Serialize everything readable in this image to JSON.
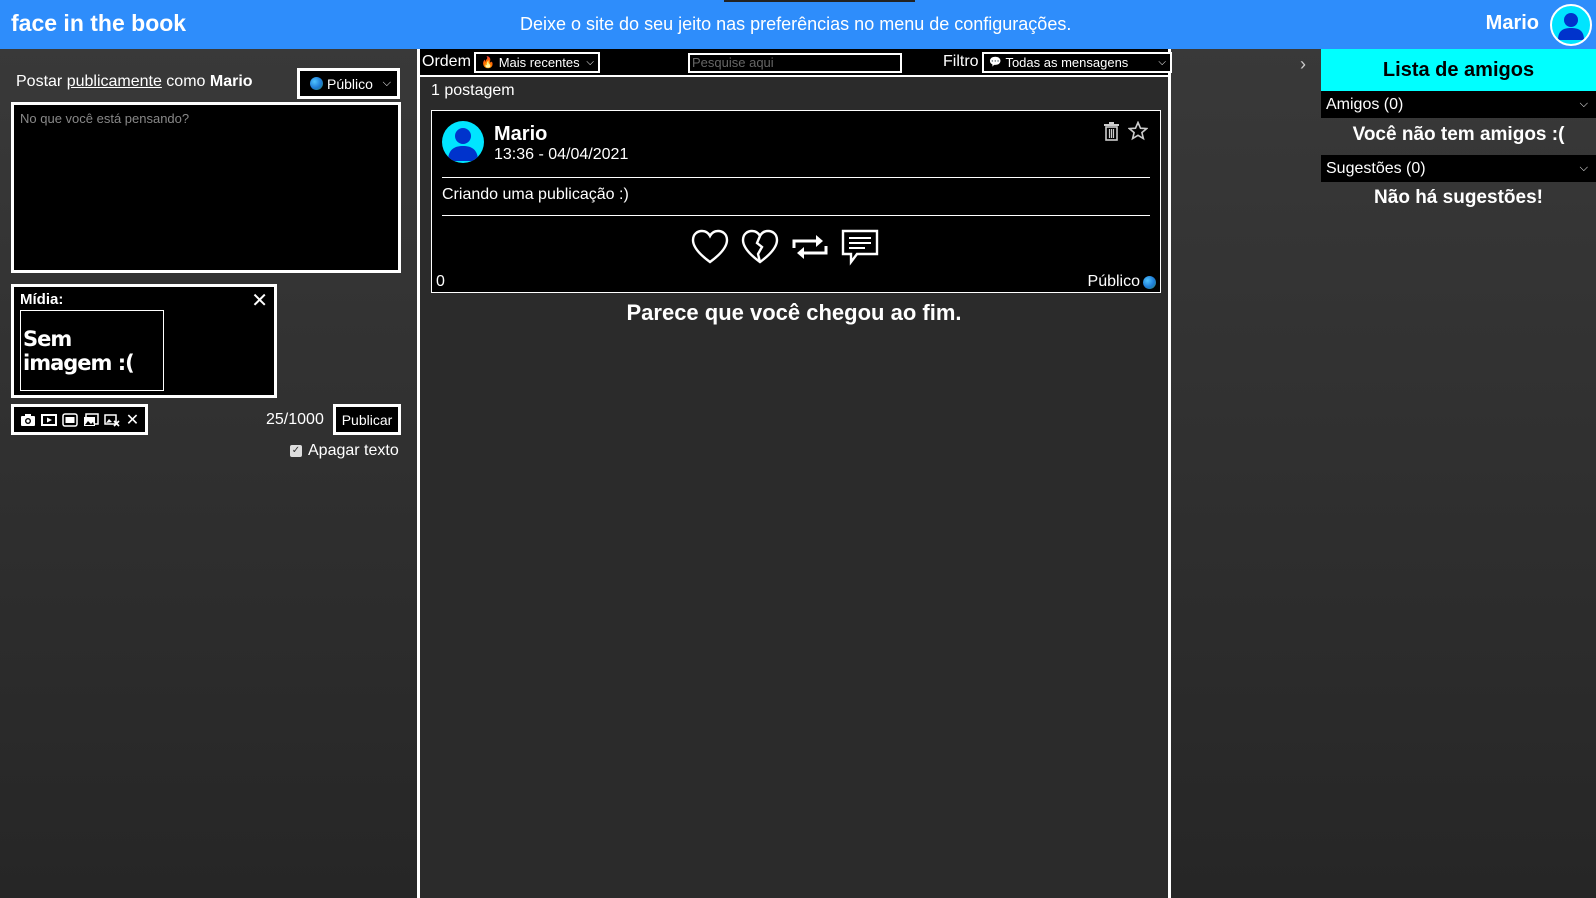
{
  "header": {
    "logo": "face in the book",
    "message": "Deixe o site do seu jeito nas preferências no menu de configurações.",
    "username": "Mario"
  },
  "composer": {
    "post_prefix": "Postar ",
    "post_link": "publicamente",
    "post_middle": " como ",
    "post_user": "Mario",
    "visibility": "Público",
    "placeholder": "No que você está pensando?",
    "media_label": "Mídia:",
    "media_empty": "Sem imagem :(",
    "char_count": "25/1000",
    "publish_label": "Publicar",
    "erase_label": "Apagar texto",
    "erase_checked": true,
    "toolbar_icons": [
      "camera-icon",
      "video-icon",
      "gif-icon",
      "gallery-icon",
      "remove-media-icon",
      "close-icon"
    ]
  },
  "feed": {
    "order_label": "Ordem",
    "order_value": "Mais recentes",
    "search_placeholder": "Pesquise aqui",
    "filter_label": "Filtro",
    "filter_value": "Todas as mensagens",
    "post_count": "1 postagem",
    "posts": [
      {
        "author": "Mario",
        "time": "13:36 - 04/04/2021",
        "text": "Criando uma publicação :)",
        "likes": "0",
        "visibility": "Público"
      }
    ],
    "end_message": "Parece que você chegou ao fim."
  },
  "friends": {
    "title": "Lista de amigos",
    "friends_label": "Amigos (0)",
    "no_friends": "Você não tem amigos :(",
    "suggestions_label": "Sugestões (0)",
    "no_suggestions": "Não há sugestões!"
  },
  "colors": {
    "header_bg": "#2e8dfb",
    "friends_title_bg": "#00ffff",
    "avatar_bg": "#00e5ff"
  }
}
